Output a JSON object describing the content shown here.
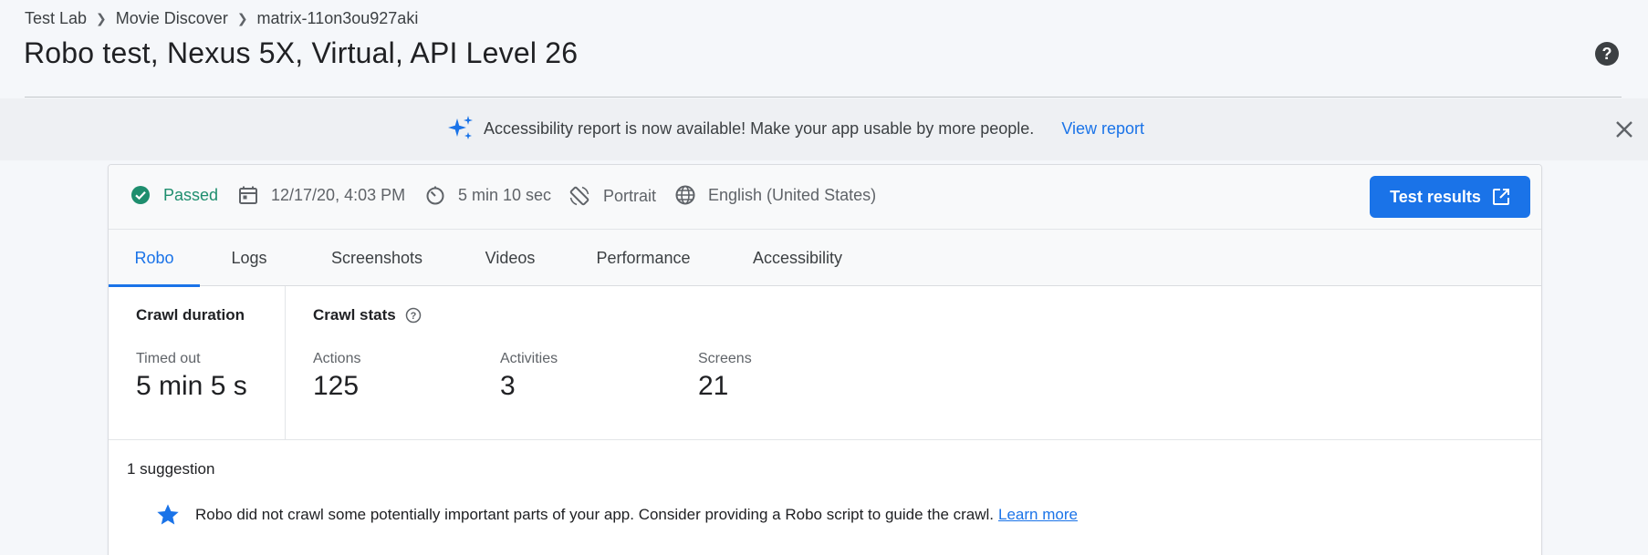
{
  "breadcrumb": [
    "Test Lab",
    "Movie Discover",
    "matrix-11on3ou927aki"
  ],
  "page_title": "Robo test, Nexus 5X, Virtual, API Level 26",
  "banner": {
    "text": "Accessibility report is now available! Make your app usable by more people.",
    "link": "View report"
  },
  "summary": {
    "status": "Passed",
    "datetime": "12/17/20, 4:03 PM",
    "duration": "5 min 10 sec",
    "orientation": "Portrait",
    "locale": "English (United States)",
    "test_results_button": "Test results"
  },
  "tabs": [
    {
      "label": "Robo",
      "active": true
    },
    {
      "label": "Logs"
    },
    {
      "label": "Screenshots"
    },
    {
      "label": "Videos"
    },
    {
      "label": "Performance"
    },
    {
      "label": "Accessibility"
    }
  ],
  "crawl_duration": {
    "title": "Crawl duration",
    "label": "Timed out",
    "value": "5 min 5 s"
  },
  "crawl_stats": {
    "title": "Crawl stats",
    "items": [
      {
        "label": "Actions",
        "value": "125"
      },
      {
        "label": "Activities",
        "value": "3"
      },
      {
        "label": "Screens",
        "value": "21"
      }
    ]
  },
  "suggestions": {
    "count_label": "1 suggestion",
    "items": [
      {
        "text": "Robo did not crawl some potentially important parts of your app. Consider providing a Robo script to guide the crawl.",
        "link": "Learn more"
      }
    ]
  },
  "colors": {
    "accent": "#1a73e8",
    "passed": "#1e8e6e",
    "star": "#1a73e8"
  },
  "icons": [
    "help-icon",
    "sparkle-icon",
    "close-icon",
    "check-circle-icon",
    "calendar-icon",
    "timer-icon",
    "screen-rotation-icon",
    "globe-icon",
    "open-in-new-icon",
    "info-icon",
    "star-icon"
  ]
}
